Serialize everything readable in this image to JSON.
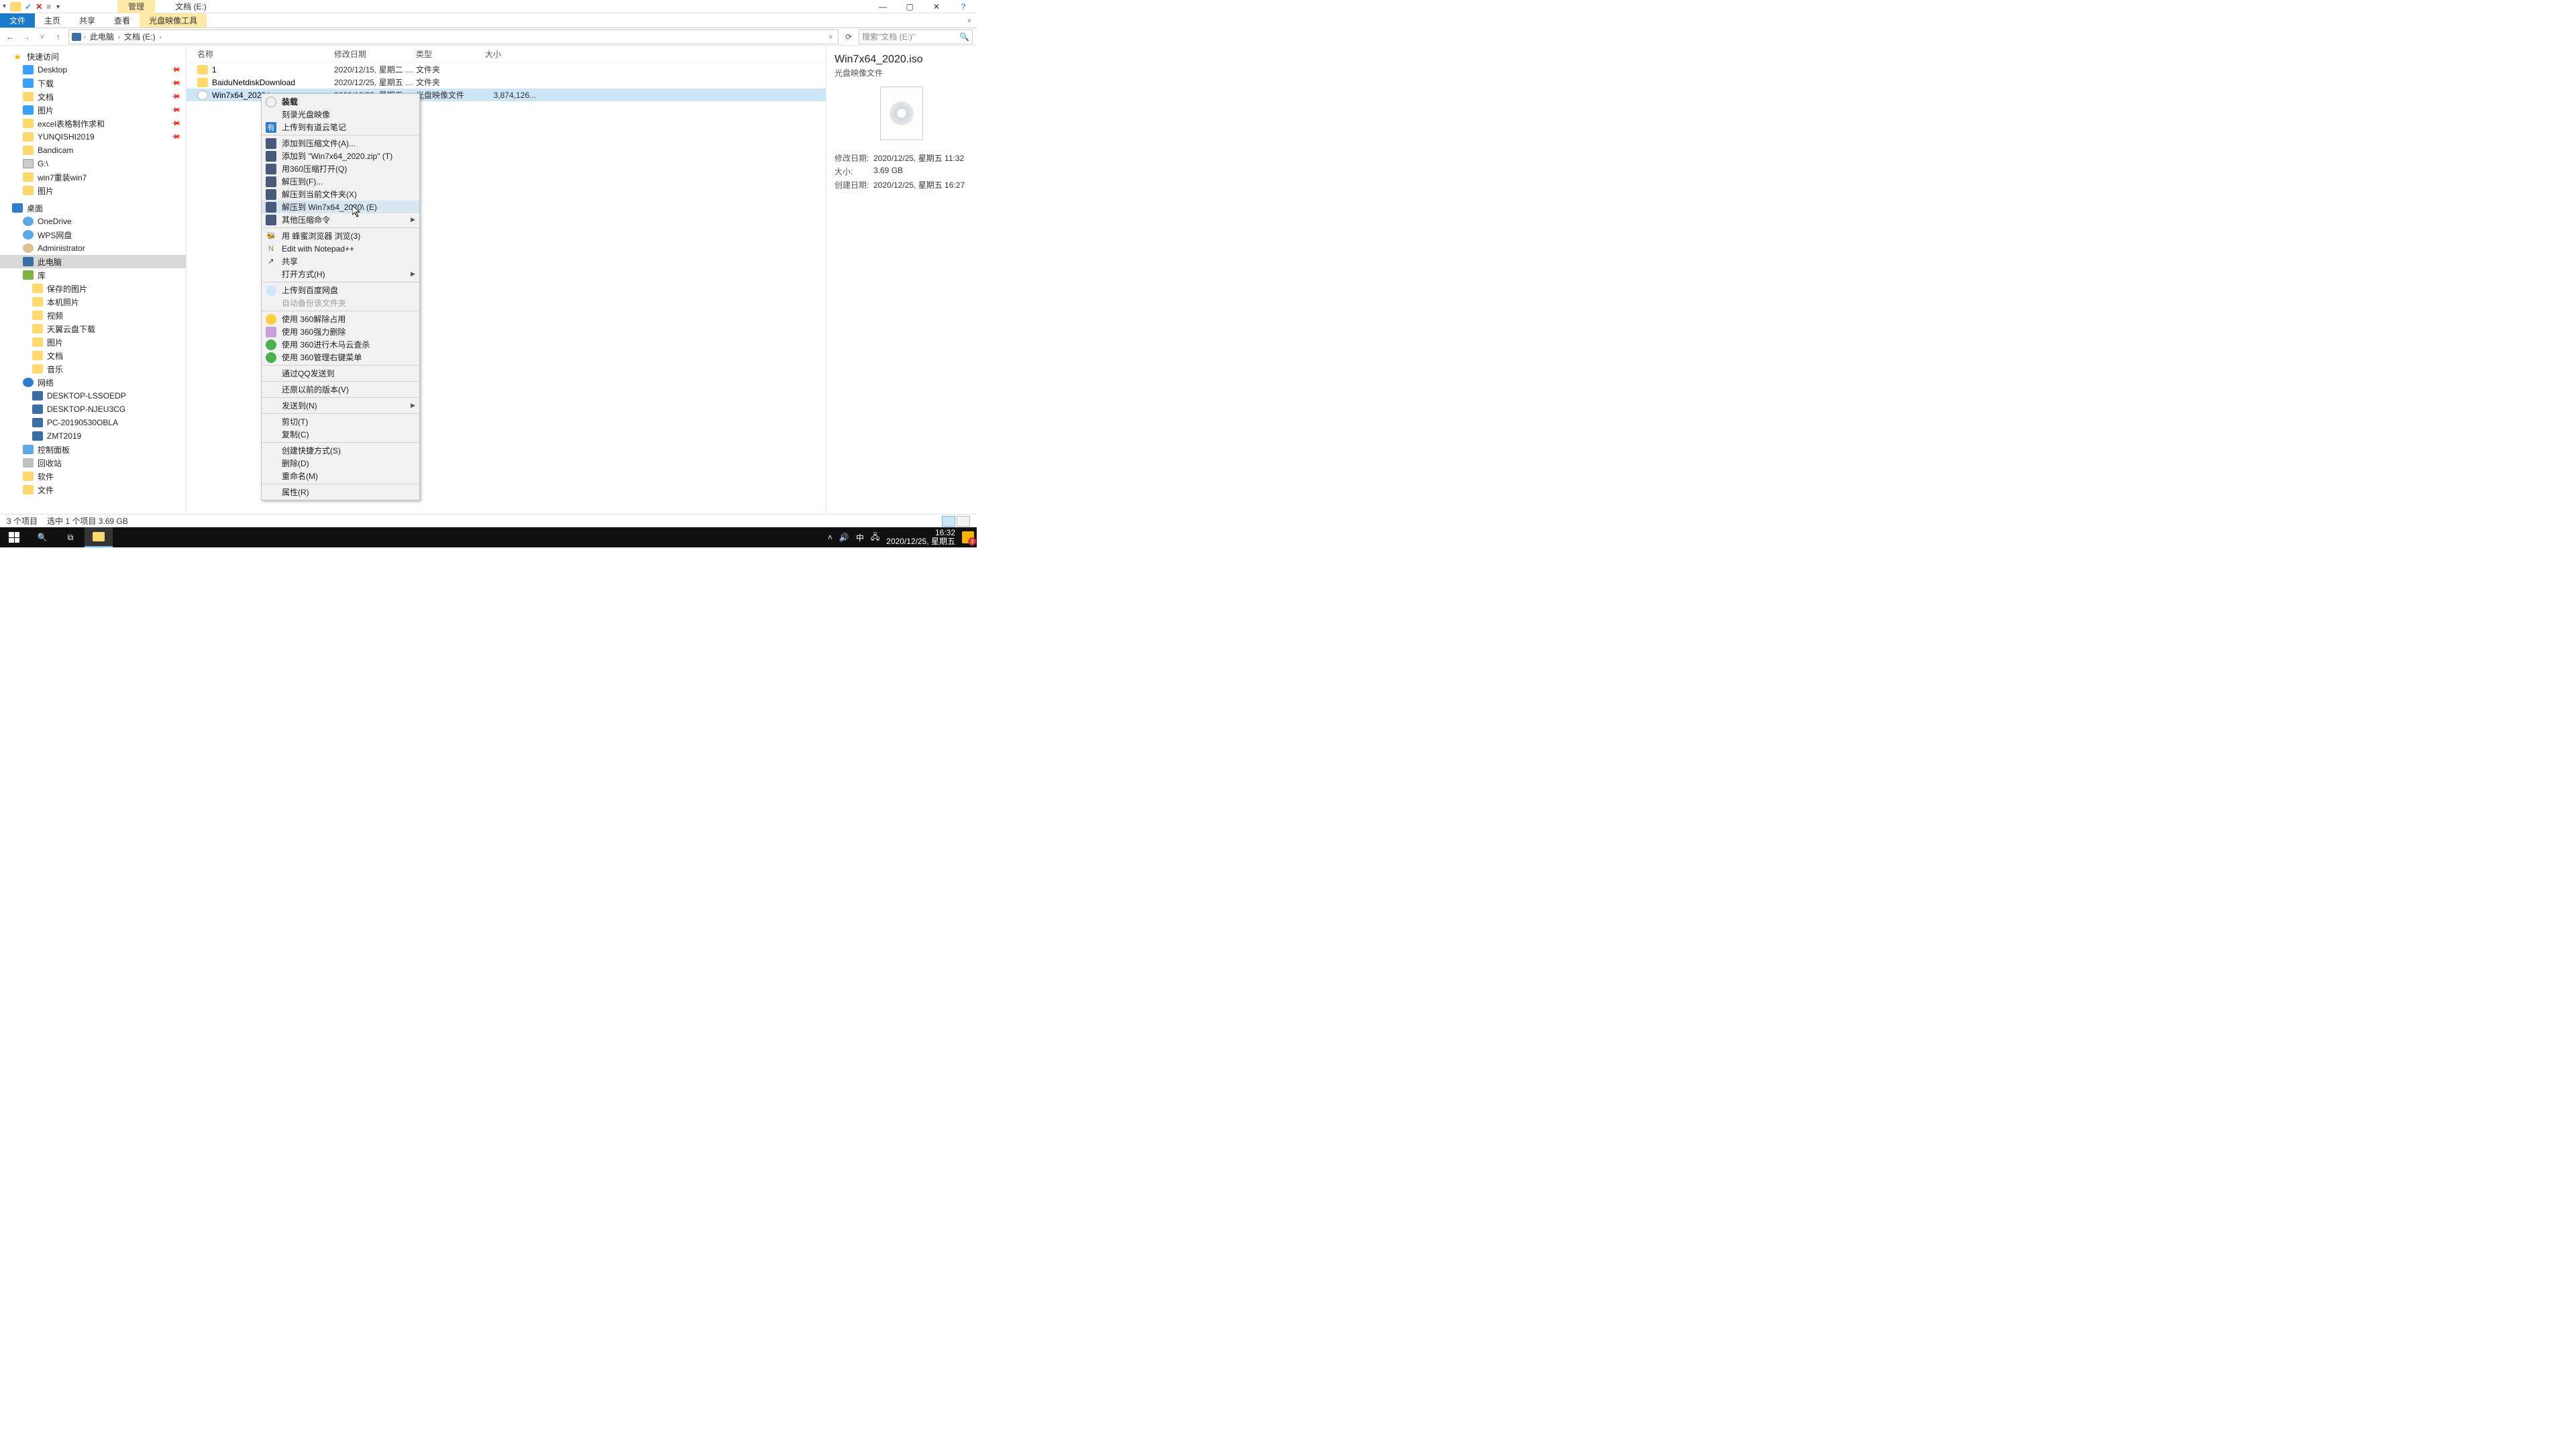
{
  "titlebar": {
    "contextual_group": "管理",
    "window_title": "文档 (E:)"
  },
  "ribbon": {
    "file": "文件",
    "home": "主页",
    "share": "共享",
    "view": "查看",
    "contextual": "光盘映像工具"
  },
  "nav": {
    "this_pc": "此电脑",
    "folder": "文档 (E:)",
    "search_placeholder": "搜索\"文档 (E:)\""
  },
  "tree": {
    "quick_access": "快速访问",
    "desktop": "Desktop",
    "downloads": "下载",
    "documents": "文档",
    "pictures": "图片",
    "excel": "excel表格制作求和",
    "yunqishi": "YUNQISHI2019",
    "bandicam": "Bandicam",
    "g_drive": "G:\\",
    "win7_reinstall": "win7重装win7",
    "pictures2": "图片",
    "desktop_zh": "桌面",
    "onedrive": "OneDrive",
    "wps": "WPS网盘",
    "administrator": "Administrator",
    "this_pc": "此电脑",
    "libraries": "库",
    "saved_pictures": "保存的图片",
    "camera_roll": "本机照片",
    "videos": "视频",
    "sky_download": "天翼云盘下载",
    "pictures_lib": "图片",
    "documents_lib": "文档",
    "music": "音乐",
    "network": "网络",
    "pc1": "DESKTOP-LSSOEDP",
    "pc2": "DESKTOP-NJEU3CG",
    "pc3": "PC-20190530OBLA",
    "pc4": "ZMT2019",
    "control_panel": "控制面板",
    "recycle_bin": "回收站",
    "software": "软件",
    "files": "文件"
  },
  "columns": {
    "name": "名称",
    "date": "修改日期",
    "type": "类型",
    "size": "大小"
  },
  "rows": [
    {
      "name": "1",
      "date": "2020/12/15, 星期二 1...",
      "type": "文件夹",
      "size": ""
    },
    {
      "name": "BaiduNetdiskDownload",
      "date": "2020/12/25, 星期五 1...",
      "type": "文件夹",
      "size": ""
    },
    {
      "name": "Win7x64_2020.iso",
      "date": "2020/12/25, 星期五 1...",
      "type": "光盘映像文件",
      "size": "3,874,126..."
    }
  ],
  "details": {
    "title": "Win7x64_2020.iso",
    "type": "光盘映像文件",
    "mod_label": "修改日期:",
    "mod_value": "2020/12/25, 星期五 11:32",
    "size_label": "大小:",
    "size_value": "3.69 GB",
    "created_label": "创建日期:",
    "created_value": "2020/12/25, 星期五 16:27"
  },
  "context_menu": {
    "mount": "装载",
    "burn": "刻录光盘映像",
    "youdao": "上传到有道云笔记",
    "add_archive": "添加到压缩文件(A)...",
    "add_zip": "添加到 \"Win7x64_2020.zip\" (T)",
    "open_360zip": "用360压缩打开(Q)",
    "extract_to": "解压到(F)...",
    "extract_here": "解压到当前文件夹(X)",
    "extract_named": "解压到 Win7x64_2020\\ (E)",
    "other_compress": "其他压缩命令",
    "bee_browse": "用 蜂蜜浏览器 浏览(3)",
    "notepadpp": "Edit with Notepad++",
    "share": "共享",
    "open_with": "打开方式(H)",
    "baidu_upload": "上传到百度网盘",
    "auto_backup": "自动备份该文件夹",
    "use360_unlock": "使用 360解除占用",
    "use360_force_del": "使用 360强力删除",
    "use360_trojan": "使用 360进行木马云查杀",
    "use360_manage": "使用 360管理右键菜单",
    "qq_send": "通过QQ发送到",
    "restore_prev": "还原以前的版本(V)",
    "send_to": "发送到(N)",
    "cut": "剪切(T)",
    "copy": "复制(C)",
    "shortcut": "创建快捷方式(S)",
    "delete": "删除(D)",
    "rename": "重命名(M)",
    "properties": "属性(R)"
  },
  "statusbar": {
    "count": "3 个项目",
    "selection": "选中 1 个项目  3.69 GB"
  },
  "taskbar": {
    "ime": "中",
    "time": "16:32",
    "date": "2020/12/25, 星期五",
    "notif_count": "3"
  }
}
